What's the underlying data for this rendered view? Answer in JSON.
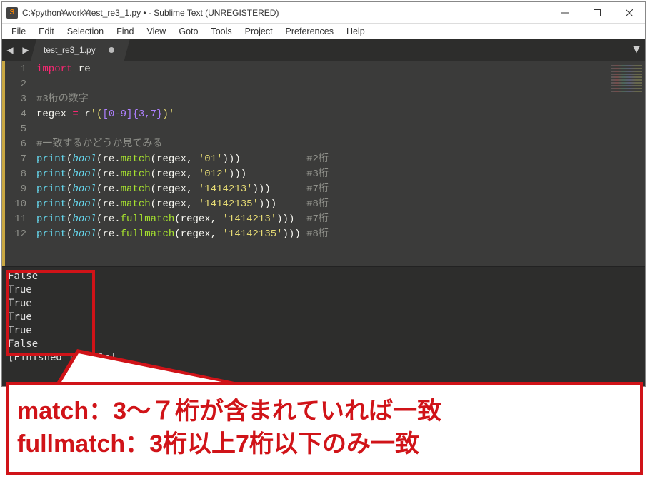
{
  "window": {
    "title": "C:¥python¥work¥test_re3_1.py • - Sublime Text (UNREGISTERED)"
  },
  "menu": [
    "File",
    "Edit",
    "Selection",
    "Find",
    "View",
    "Goto",
    "Tools",
    "Project",
    "Preferences",
    "Help"
  ],
  "tab": {
    "name": "test_re3_1.py",
    "dirty": true
  },
  "line_numbers": [
    "1",
    "2",
    "3",
    "4",
    "5",
    "6",
    "7",
    "8",
    "9",
    "10",
    "11",
    "12"
  ],
  "code": {
    "l1": {
      "a": "import",
      "b": " re"
    },
    "l3": "#3桁の数字",
    "l4": {
      "a": "regex ",
      "op": "=",
      "b": " r",
      "s1": "'(",
      "re": "[0-9]",
      "q": "{3,7}",
      "s2": ")'"
    },
    "l6": "#一致するかどうか見てみる",
    "calls": [
      {
        "fn": "match",
        "arg": "'01'",
        "cmt": "#2桁"
      },
      {
        "fn": "match",
        "arg": "'012'",
        "cmt": "#3桁"
      },
      {
        "fn": "match",
        "arg": "'1414213'",
        "cmt": "#7桁"
      },
      {
        "fn": "match",
        "arg": "'14142135'",
        "cmt": "#8桁"
      },
      {
        "fn": "fullmatch",
        "arg": "'1414213'",
        "cmt": "#7桁"
      },
      {
        "fn": "fullmatch",
        "arg": "'14142135'",
        "cmt": "#8桁"
      }
    ],
    "print": "print",
    "bool": "bool",
    "re": "re",
    "regexvar": "regex"
  },
  "console_lines": [
    "False",
    "True",
    "True",
    "True",
    "True",
    "False",
    "[Finished in 0.1s]"
  ],
  "callout": {
    "line1": "match：3～７桁が含まれていれば一致",
    "line2": "fullmatch：3桁以上7桁以下のみ一致"
  }
}
